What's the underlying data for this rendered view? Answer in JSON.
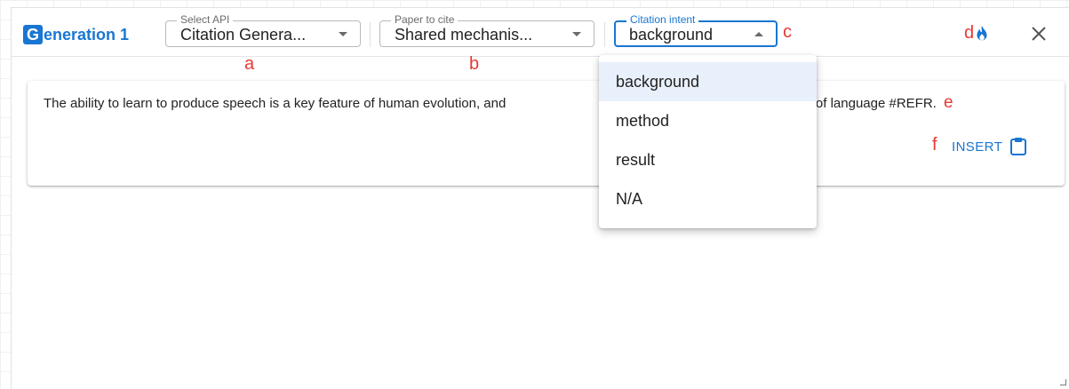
{
  "header": {
    "badge_letter": "G",
    "title_rest": "eneration 1",
    "close_symbol": "✕",
    "fire_icon": "fire-icon",
    "close_icon": "close-icon"
  },
  "selects": {
    "api": {
      "label": "Select API",
      "value": "Citation Genera..."
    },
    "paper": {
      "label": "Paper to cite",
      "value": "Shared mechanis..."
    },
    "intent": {
      "label": "Citation intent",
      "value": "background"
    }
  },
  "annotations": {
    "a": "a",
    "b": "b",
    "c": "c",
    "d": "d",
    "e": "e",
    "f": "f"
  },
  "generation": {
    "text_part1": "The ability to learn to produce speech is a key feature of human evolution, and",
    "text_part2": "al factor in the evolution of language #REFR.",
    "insert_label": "INSERT",
    "clipboard_icon": "clipboard-icon"
  },
  "intent_menu": {
    "options": [
      "background",
      "method",
      "result",
      "N/A"
    ],
    "selected": "background"
  },
  "colors": {
    "accent": "#1976d2",
    "annotation": "#e53935",
    "selected_option_bg": "#e8f0fb"
  }
}
